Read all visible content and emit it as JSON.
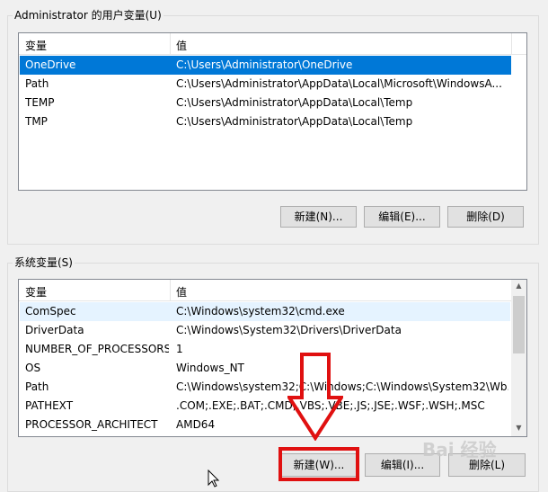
{
  "user_vars": {
    "title": "Administrator 的用户变量(U)",
    "col_var": "变量",
    "col_val": "值",
    "rows": [
      {
        "name": "OneDrive",
        "value": "C:\\Users\\Administrator\\OneDrive",
        "selected": true
      },
      {
        "name": "Path",
        "value": "C:\\Users\\Administrator\\AppData\\Local\\Microsoft\\WindowsA...",
        "selected": false
      },
      {
        "name": "TEMP",
        "value": "C:\\Users\\Administrator\\AppData\\Local\\Temp",
        "selected": false
      },
      {
        "name": "TMP",
        "value": "C:\\Users\\Administrator\\AppData\\Local\\Temp",
        "selected": false
      }
    ],
    "new_label": "新建(N)...",
    "edit_label": "编辑(E)...",
    "delete_label": "删除(D)"
  },
  "system_vars": {
    "title": "系统变量(S)",
    "col_var": "变量",
    "col_val": "值",
    "rows": [
      {
        "name": "ComSpec",
        "value": "C:\\Windows\\system32\\cmd.exe"
      },
      {
        "name": "DriverData",
        "value": "C:\\Windows\\System32\\Drivers\\DriverData"
      },
      {
        "name": "NUMBER_OF_PROCESSORS",
        "value": "1"
      },
      {
        "name": "OS",
        "value": "Windows_NT"
      },
      {
        "name": "Path",
        "value": "C:\\Windows\\system32;C:\\Windows;C:\\Windows\\System32\\Wb..."
      },
      {
        "name": "PATHEXT",
        "value": ".COM;.EXE;.BAT;.CMD;.VBS;.VBE;.JS;.JSE;.WSF;.WSH;.MSC"
      },
      {
        "name": "PROCESSOR_ARCHITECT",
        "value": "AMD64"
      }
    ],
    "new_label": "新建(W)...",
    "edit_label": "编辑(I)...",
    "delete_label": "删除(L)"
  },
  "watermark": "Bai 经验",
  "colors": {
    "selection": "#0078d7",
    "highlight": "#e01010"
  }
}
